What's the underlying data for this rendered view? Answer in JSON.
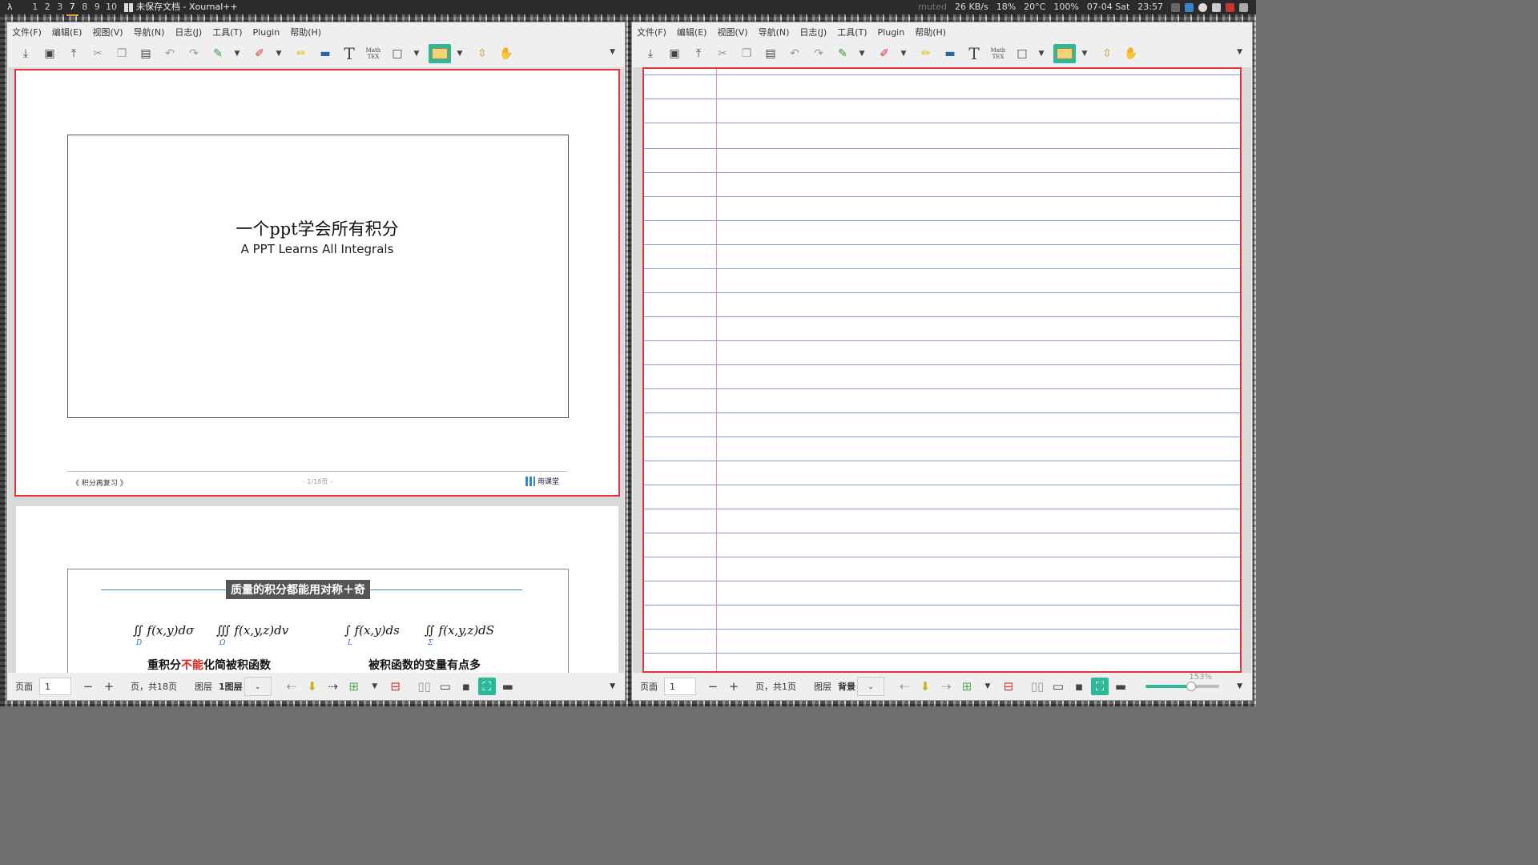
{
  "panel": {
    "launcher": "λ",
    "workspaces": [
      "1",
      "2",
      "3",
      "7",
      "8",
      "9",
      "10"
    ],
    "active_workspace": "7",
    "task_title": "未保存文档 - Xournal++",
    "muted": "muted",
    "net": "26 KB/s",
    "cpu": "18%",
    "temp": "20°C",
    "battery": "100%",
    "date": "07-04 Sat",
    "time": "23:57"
  },
  "menu": [
    "文件(F)",
    "编辑(E)",
    "视图(V)",
    "导航(N)",
    "日志(J)",
    "工具(T)",
    "Plugin",
    "帮助(H)"
  ],
  "toolbar_icons": [
    "save-icon",
    "new-page-icon",
    "export-icon",
    "cut-icon",
    "copy-icon",
    "paste-icon",
    "undo-icon",
    "redo-icon",
    "pen-icon",
    "eraser-icon",
    "highlighter-icon",
    "image-icon",
    "text-icon",
    "math-tex-icon",
    "shape-icon",
    "select-rect-icon",
    "vertical-space-icon",
    "hand-icon"
  ],
  "toolbar_mathtex": "Math\nTEX",
  "left": {
    "slide1": {
      "title": "一个ppt学会所有积分",
      "subtitle": "A PPT Learns All Integrals",
      "footer_left": "《 积分再复习 》",
      "footer_mid": "- 1/18页 -",
      "footer_logo": "雨课堂"
    },
    "slide2": {
      "title": "质量的积分都能用对称＋奇",
      "formula1": "∬ f(x,y)dσ",
      "formula1_sub": "D",
      "formula2": "∭ f(x,y,z)dv",
      "formula2_sub": "Ω",
      "formula3": "∫ f(x,y)ds",
      "formula3_sub": "L",
      "formula4": "∬ f(x,y,z)dS",
      "formula4_sub": "Σ",
      "text1_a": "重积分",
      "text1_red": "不能",
      "text1_b": "化简被积函数",
      "text2": "被积函数的变量有点多"
    },
    "status": {
      "page_label": "页面",
      "page_value": "1",
      "of_pages": "页，共18页",
      "layer_label": "图层",
      "layer_value": "1图层"
    }
  },
  "right": {
    "status": {
      "page_label": "页面",
      "page_value": "1",
      "of_pages": "页，共1页",
      "layer_label": "图层",
      "layer_value": "背景",
      "zoom": "153%"
    }
  },
  "colors": {
    "accent": "#2db89a",
    "selection": "#e1343b",
    "ruled_line": "#7d9cd9",
    "margin_line": "#e88aa0"
  }
}
